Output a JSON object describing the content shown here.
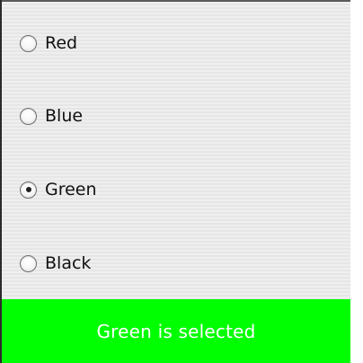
{
  "radio_group": {
    "options": [
      {
        "label": "Red",
        "selected": false
      },
      {
        "label": "Blue",
        "selected": false
      },
      {
        "label": "Green",
        "selected": true
      },
      {
        "label": "Black",
        "selected": false
      }
    ]
  },
  "status": {
    "text": "Green is selected",
    "background_color": "#00ff00",
    "text_color": "#ffffff"
  }
}
